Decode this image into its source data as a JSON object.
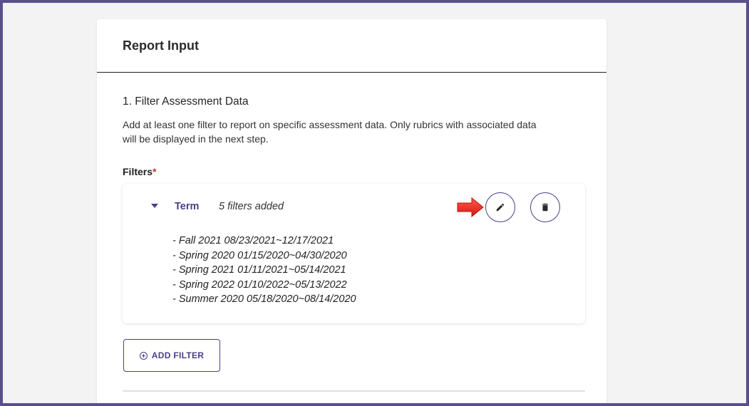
{
  "card": {
    "title": "Report Input"
  },
  "section": {
    "title": "1. Filter Assessment Data",
    "description": "Add at least one filter to report on specific assessment data. Only rubrics with associated data will be displayed in the next step."
  },
  "filters": {
    "label": "Filters",
    "required_mark": "*",
    "groups": [
      {
        "name": "Term",
        "count_text": "5 filters added",
        "expanded": true,
        "items": [
          "- Fall 2021 08/23/2021~12/17/2021",
          "- Spring 2020 01/15/2020~04/30/2020",
          "- Spring 2021 01/11/2021~05/14/2021",
          "- Spring 2022 01/10/2022~05/13/2022",
          "- Summer 2020 05/18/2020~08/14/2020"
        ]
      }
    ]
  },
  "actions": {
    "add_filter_label": "ADD FILTER",
    "edit_icon": "pencil-icon",
    "delete_icon": "trash-icon"
  },
  "colors": {
    "frame": "#5a4f8c",
    "accent": "#4a3f86",
    "required": "#c0392b",
    "pointer_arrow": "#e8261c"
  }
}
